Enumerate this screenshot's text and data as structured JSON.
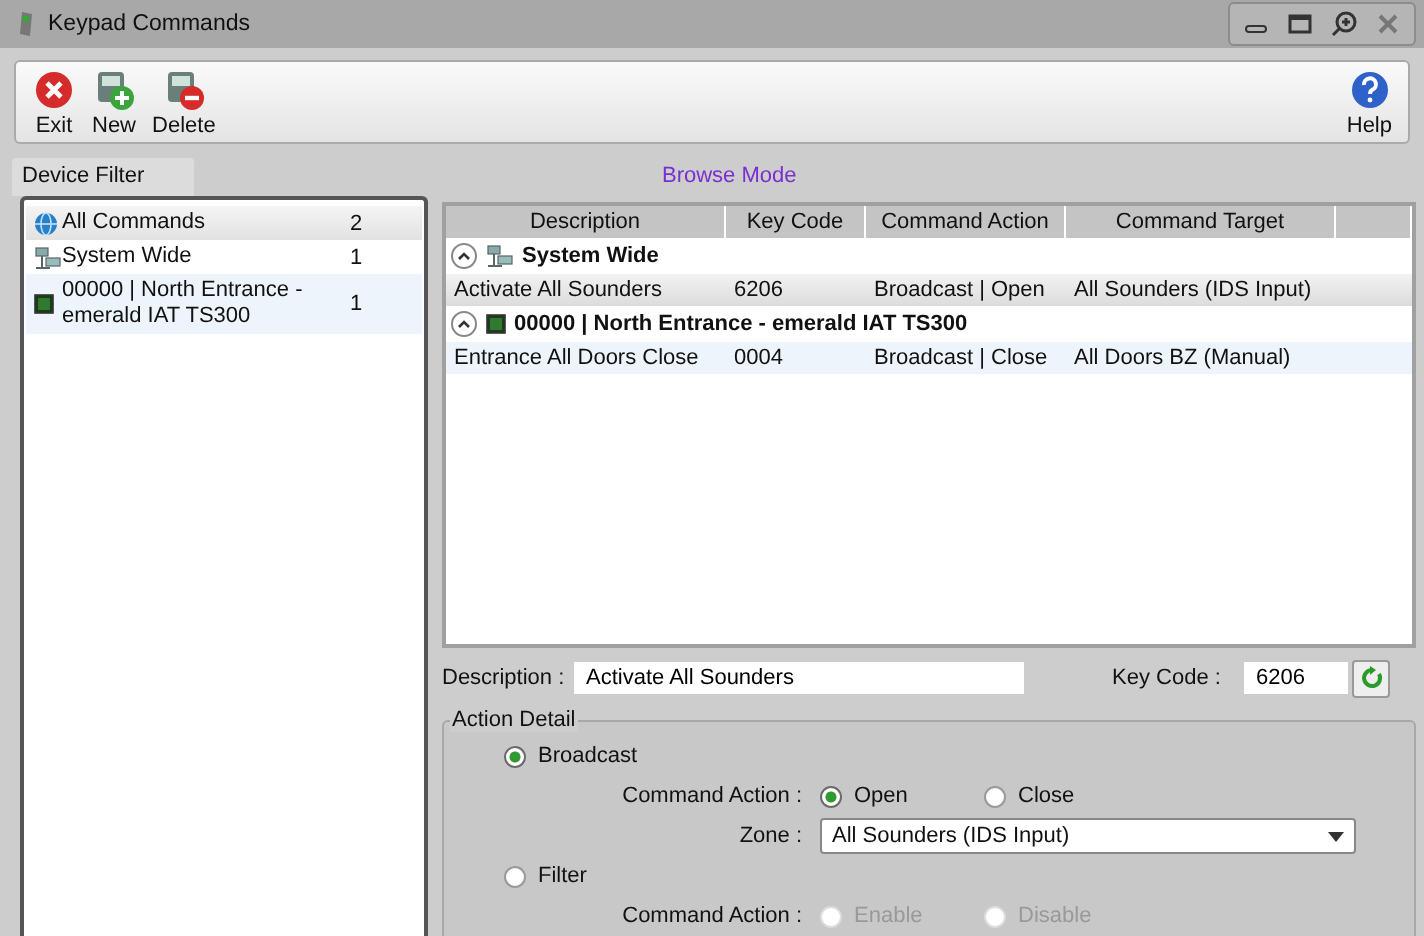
{
  "window": {
    "title": "Keypad Commands"
  },
  "toolbar": [
    {
      "label": "Exit",
      "kind": "exit"
    },
    {
      "label": "New",
      "kind": "new"
    },
    {
      "label": "Delete",
      "kind": "delete"
    },
    {
      "label": "Help",
      "kind": "help"
    }
  ],
  "mode": "Browse Mode",
  "device_filter": {
    "title": "Device Filter",
    "items": [
      {
        "label": "All Commands",
        "count": "2",
        "kind": "globe",
        "selected": true
      },
      {
        "label": "System Wide",
        "count": "1",
        "kind": "network",
        "selected": false
      },
      {
        "label": "00000 | North Entrance - emerald IAT TS300",
        "count": "1",
        "kind": "device",
        "selected": false
      }
    ]
  },
  "table": {
    "columns": [
      "Description",
      "Key Code",
      "Command Action",
      "Command Target"
    ],
    "groups": [
      {
        "title": "System Wide",
        "kind": "network",
        "expanded": true,
        "rows": [
          {
            "cells": [
              "Activate All Sounders",
              "6206",
              "Broadcast | Open",
              "All Sounders (IDS Input)"
            ],
            "selected": true
          }
        ]
      },
      {
        "title": "00000 | North Entrance - emerald IAT TS300",
        "kind": "device",
        "expanded": true,
        "rows": [
          {
            "cells": [
              "Entrance All Doors Close",
              "0004",
              "Broadcast | Close",
              "All Doors BZ (Manual)"
            ],
            "selected": false
          }
        ]
      }
    ]
  },
  "form": {
    "description_label": "Description :",
    "description": "Activate All Sounders",
    "key_code_label": "Key Code :",
    "key_code": "6206",
    "action_detail": {
      "title": "Action Detail",
      "broadcast": {
        "label": "Broadcast",
        "selected": true,
        "action_label": "Command Action :",
        "options": [
          {
            "label": "Open",
            "selected": true,
            "disabled": false
          },
          {
            "label": "Close",
            "selected": false,
            "disabled": false
          }
        ],
        "zone_label": "Zone :",
        "zone": "All Sounders (IDS Input)"
      },
      "filter": {
        "label": "Filter",
        "selected": false,
        "action_label": "Command Action :",
        "options": [
          {
            "label": "Enable",
            "selected": false,
            "disabled": true
          },
          {
            "label": "Disable",
            "selected": false,
            "disabled": true
          }
        ]
      }
    }
  }
}
